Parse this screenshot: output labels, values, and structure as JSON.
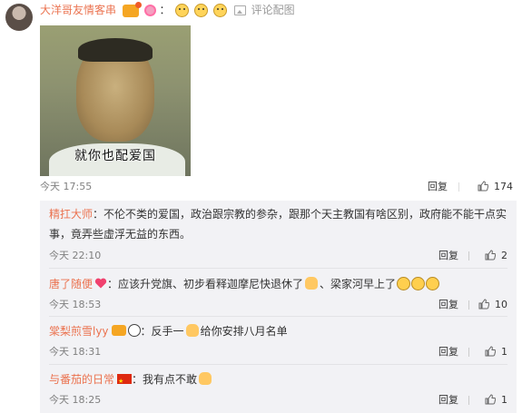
{
  "main": {
    "username": "大洋哥友情客串",
    "separator": "：",
    "image_link": "评论配图",
    "meme_caption": "就你也配爱国",
    "time": "今天 17:55",
    "reply_label": "回复",
    "like_count": "174"
  },
  "replies": [
    {
      "username": "精扛大师",
      "text": "：不伦不类的爱国，政治跟宗教的参杂，跟那个天主教国有啥区别，政府能不能干点实事，竟弄些虚浮无益的东西。",
      "time": "今天 22:10",
      "reply_label": "回复",
      "like_count": "2"
    },
    {
      "username": "唐了随便",
      "text_a": "：应该升党旗、初步看释迦摩尼快退休了",
      "text_b": "、梁家河早上了",
      "time": "今天 18:53",
      "reply_label": "回复",
      "like_count": "10"
    },
    {
      "username": "棠梨煎雪lyy",
      "text_a": "：反手一",
      "text_b": "给你安排八月名单",
      "time": "今天 18:31",
      "reply_label": "回复",
      "like_count": "1"
    },
    {
      "username": "与番茄的日常",
      "text": "：我有点不敢",
      "time": "今天 18:25",
      "reply_label": "回复",
      "like_count": "1"
    }
  ],
  "colors": {
    "username": "#eb7350",
    "meta": "#808080",
    "reply_bg": "#f2f2f5"
  },
  "icons": [
    "avatar",
    "vip-badge",
    "donut-badge",
    "doge-emoji",
    "image-icon",
    "thumb-up-icon",
    "heart-emoji",
    "peace-hand-emoji",
    "cry-emoji",
    "panda-emoji",
    "thumb-emoji",
    "china-flag"
  ]
}
